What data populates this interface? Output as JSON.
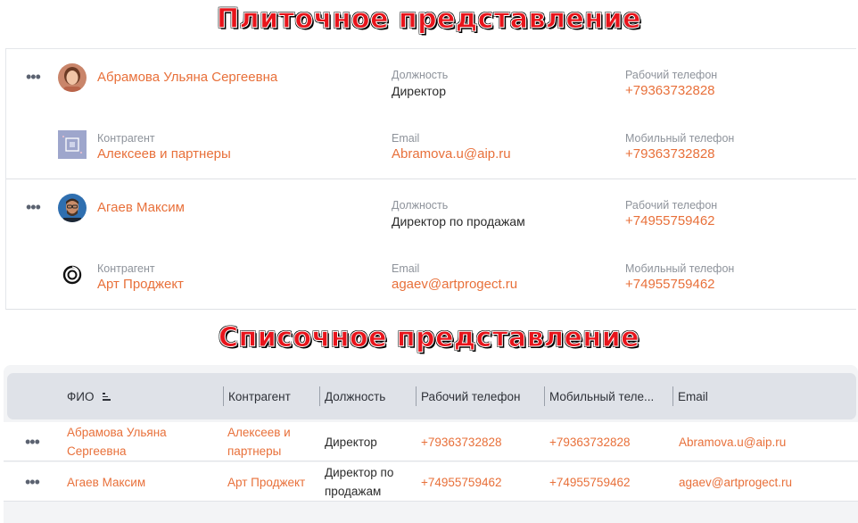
{
  "banners": {
    "tile_view": "Плиточное представление",
    "list_view": "Списочное представление"
  },
  "tiles": [
    {
      "name": "Абрамова Ульяна Сергеевна",
      "company_label": "Контрагент",
      "company": "Алексеев и партнеры",
      "position_label": "Должность",
      "position": "Директор",
      "email_label": "Email",
      "email": "Abramova.u@aip.ru",
      "work_phone_label": "Рабочий телефон",
      "work_phone": "+79363732828",
      "mobile_phone_label": "Мобильный телефон",
      "mobile_phone": "+79363732828"
    },
    {
      "name": "Агаев Максим",
      "company_label": "Контрагент",
      "company": "Арт Проджект",
      "position_label": "Должность",
      "position": "Директор по продажам",
      "email_label": "Email",
      "email": "agaev@artprogect.ru",
      "work_phone_label": "Рабочий телефон",
      "work_phone": "+74955759462",
      "mobile_phone_label": "Мобильный телефон",
      "mobile_phone": "+74955759462"
    }
  ],
  "table": {
    "headers": {
      "fio": "ФИО",
      "company": "Контрагент",
      "position": "Должность",
      "work_phone": "Рабочий телефон",
      "mobile_phone": "Мобильный теле...",
      "email": "Email"
    },
    "rows": [
      {
        "fio_line1": "Абрамова Ульяна",
        "fio_line2": "Сергеевна",
        "company_line1": "Алексеев и",
        "company_line2": "партнеры",
        "position": "Директор",
        "work_phone": "+79363732828",
        "mobile_phone": "+79363732828",
        "email": "Abramova.u@aip.ru"
      },
      {
        "fio": "Агаев Максим",
        "company": "Арт Проджект",
        "position_line1": "Директор по",
        "position_line2": "продажам",
        "work_phone": "+74955759462",
        "mobile_phone": "+74955759462",
        "email": "agaev@artprogect.ru"
      }
    ]
  },
  "icons": {
    "more": "more-dots-icon",
    "sort": "sort-icon"
  },
  "colors": {
    "accent": "#e8703a",
    "banner": "#e8141b",
    "header_bg": "#dfe2e8"
  }
}
